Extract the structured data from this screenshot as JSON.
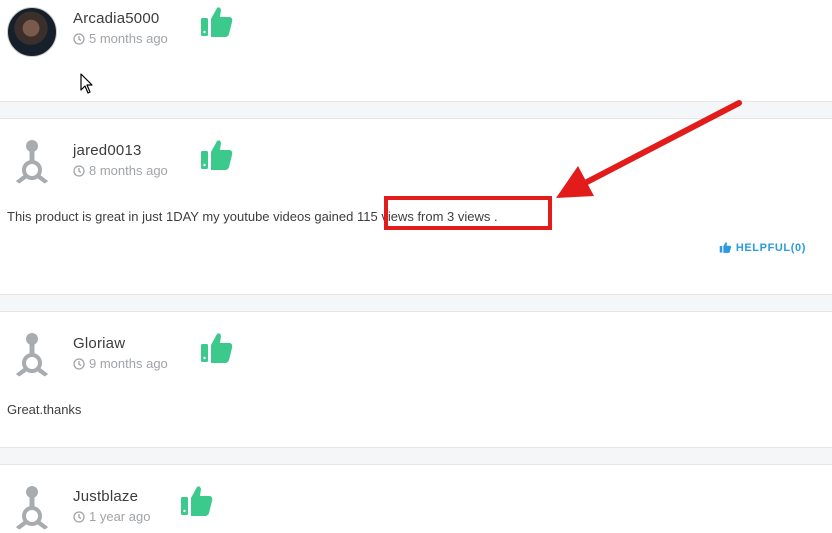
{
  "reviews": [
    {
      "username": "Arcadia5000",
      "time": "5 months ago",
      "avatar": "photo-avatar"
    },
    {
      "username": "jared0013",
      "time": "8 months ago",
      "avatar": "default-avatar",
      "text_before": "This product is great in just 1DAY my youtube videos gained ",
      "text_highlight": "115 views from 3 views .",
      "helpful_label": "HELPFUL(0)"
    },
    {
      "username": "Gloriaw",
      "time": "9 months ago",
      "avatar": "default-avatar",
      "text": "Great.thanks"
    },
    {
      "username": "Justblaze",
      "time": "1 year ago",
      "avatar": "default-avatar"
    }
  ],
  "icons": {
    "thumb": "thumbs-up-icon",
    "clock": "clock-icon",
    "helpful": "thumbs-up-icon"
  },
  "colors": {
    "thumb_green": "#3cc98c",
    "helpful_blue": "#2a9be0",
    "annotation_red": "#e21b1b",
    "separator_bg": "#f5f6f7"
  }
}
